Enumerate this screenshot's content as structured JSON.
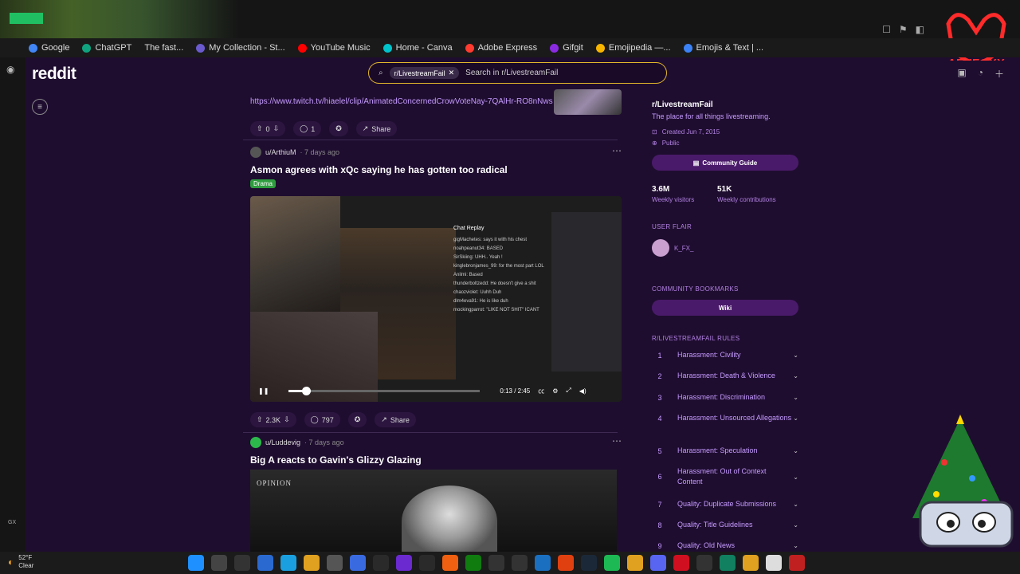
{
  "browser": {
    "bookmarks": [
      "Google",
      "ChatGPT",
      "The fast...",
      "My Collection - St...",
      "YouTube Music",
      "Home - Canva",
      "Adobe Express",
      "Gifgit",
      "Emojipedia —...",
      "Emojis & Text | ..."
    ],
    "bookmark_colors": [
      "#4285f4",
      "#10a37f",
      "#888888",
      "#6a5acd",
      "#ff0000",
      "#00c4cc",
      "#ff3b30",
      "#8a2be2",
      "#f7b500",
      "#3b82f6"
    ],
    "corner_logo": "AFKFOXX"
  },
  "header": {
    "logo": "reddit",
    "search_chip": "r/LivestreamFail",
    "search_placeholder": "Search in r/LivestreamFail"
  },
  "post_prev": {
    "link": "https://www.twitch.tv/hiaelel/clip/AnimatedConcernedCrowVoteNay-7QAlHr-RO8nNws...",
    "votes": "0",
    "comments": "1",
    "share": "Share"
  },
  "post1": {
    "author": "u/ArthiuM",
    "time": "· 7 days ago",
    "title": "Asmon agrees with xQc saying he has gotten too radical",
    "flair": "Drama",
    "video": {
      "chat_title": "Chat Replay",
      "chat_lines": [
        "gigMachetes: says it with his chest",
        "noahpeanut34: BASED",
        "SirSkiing: UHH.. Yeah !",
        "kinglebronjames_99: for the most part LOL",
        "Anilmi: Based",
        "thunderboltzedd: He doesn't give a shit",
        "chaozviolet: Uuhh Duh",
        "dlm4eva91: He is like duh",
        "mockingparrot: \"LIKE NOT SHIT\" ICANT"
      ],
      "time": "0:13 / 2:45",
      "progress": 0.09
    },
    "votes": "2.3K",
    "comments": "797",
    "share": "Share"
  },
  "post2": {
    "author": "u/Luddevig",
    "time": "· 7 days ago",
    "title": "Big A reacts to Gavin's Glizzy Glazing",
    "thumb_tag": "OPINION"
  },
  "sidebar": {
    "name": "r/LivestreamFail",
    "desc": "The place for all things livestreaming.",
    "created": "Created Jun 7, 2015",
    "visibility": "Public",
    "guide": "Community Guide",
    "stats": [
      {
        "value": "3.6M",
        "label": "Weekly visitors"
      },
      {
        "value": "51K",
        "label": "Weekly contributions"
      }
    ],
    "user_flair_head": "USER FLAIR",
    "user_flair": "K_FX_",
    "bookmarks_head": "COMMUNITY BOOKMARKS",
    "wiki": "Wiki",
    "rules_head": "R/LIVESTREAMFAIL RULES",
    "rules": [
      {
        "n": "1",
        "t": "Harassment: Civility"
      },
      {
        "n": "2",
        "t": "Harassment: Death & Violence"
      },
      {
        "n": "3",
        "t": "Harassment: Discrimination"
      },
      {
        "n": "4",
        "t": "Harassment: Unsourced Allegations"
      },
      {
        "n": "5",
        "t": "Harassment: Speculation"
      },
      {
        "n": "6",
        "t": "Harassment: Out of Context Content"
      },
      {
        "n": "7",
        "t": "Quality: Duplicate Submissions"
      },
      {
        "n": "8",
        "t": "Quality: Title Guidelines"
      },
      {
        "n": "9",
        "t": "Quality: Old News"
      }
    ]
  },
  "taskbar": {
    "temp": "52°F",
    "cond": "Clear"
  },
  "left": {
    "gx": "GX"
  }
}
